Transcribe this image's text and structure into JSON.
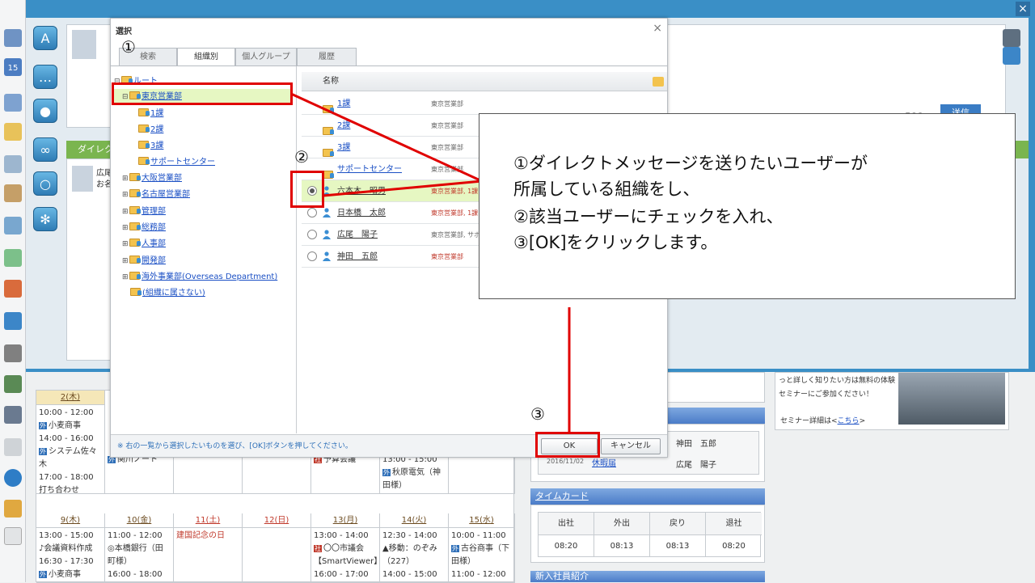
{
  "window": {
    "close_label": "×"
  },
  "calendar": {
    "week1": {
      "headers": [
        "2(木)"
      ],
      "cells": [
        {
          "t1": "10:00 - 12:00",
          "e1": "小麦商事",
          "t2": "14:00 - 16:00",
          "e2": "システム佐々木",
          "t3": "17:00 - 18:00",
          "e3": "打ち合わせ"
        },
        {
          "e1": "関川ノート"
        },
        {
          "e1": "予算会議"
        },
        {
          "t1": "13:00 - 15:00",
          "e1": "秋原電気（神田様）"
        }
      ]
    },
    "week2": {
      "headers": [
        "9(木)",
        "10(金)",
        "11(土)",
        "12(日)",
        "13(月)",
        "14(火)",
        "15(水)"
      ],
      "cells": [
        {
          "t1": "13:00 - 15:00",
          "e1": "会議資料作成",
          "t2": "16:30 - 17:30",
          "e2": "小麦商事"
        },
        {
          "t1": "11:00 - 12:00",
          "e1": "本橋銀行（田町様）",
          "t2": "16:00 - 18:00"
        },
        {
          "e1": "建国記念の日"
        },
        {},
        {
          "t1": "13:00 - 14:00",
          "e1": "〇〇市議会【SmartViewer】",
          "t2": "16:00 - 17:00"
        },
        {
          "t1": "12:30 - 14:00",
          "e1": "移動：のぞみ（227）",
          "t2": "14:00 - 15:00"
        },
        {
          "t1": "10:00 - 11:00",
          "e1": "古谷商事（下田様）",
          "t2": "11:00 - 12:00"
        }
      ]
    }
  },
  "right": {
    "seminar_text": "っと詳しく知りたい方は無料の体験セミナーにご参加ください！",
    "seminar_link_prefix": "セミナー詳細は<",
    "seminar_link": "こちら",
    "seminar_link_suffix": ">",
    "substitute": {
      "date": "2016/11/02",
      "link": "休暇届",
      "names": [
        "神田　五郎",
        "広尾　陽子"
      ]
    },
    "timecard": {
      "title": "タイムカード",
      "headers": [
        "出社",
        "外出",
        "戻り",
        "退社"
      ],
      "values": [
        "08:20",
        "08:13",
        "08:13",
        "08:20"
      ]
    },
    "newcomer_title": "新入社員紹介"
  },
  "behind": {
    "direct_label": "ダイレク",
    "sender_name": "広尾",
    "sender_prefix": "お名",
    "send_btn": "送信",
    "count": "500"
  },
  "dialog": {
    "title": "選択",
    "close": "×",
    "tabs": [
      "検索",
      "組織別",
      "個人グループ",
      "履歴"
    ],
    "tree": {
      "root": "ルート",
      "selected": "東京営業部",
      "children": [
        "1課",
        "2課",
        "3課",
        "サポートセンター"
      ],
      "others": [
        "大阪営業部",
        "名古屋営業部",
        "管理部",
        "総務部",
        "人事部",
        "開発部",
        "海外事業部(Overseas Department)",
        "(組織に属さない)"
      ]
    },
    "list_header": "名称",
    "folders": [
      {
        "name": "1課",
        "org": "東京営業部"
      },
      {
        "name": "2課",
        "org": "東京営業部"
      },
      {
        "name": "3課",
        "org": "東京営業部"
      },
      {
        "name": "サポートセンター",
        "org": "東京営業部"
      }
    ],
    "users": [
      {
        "name": "六本木　昭男",
        "org": "東京営業部, 1課"
      },
      {
        "name": "日本橋　太郎",
        "org": "東京営業部, 1課"
      },
      {
        "name": "広尾　陽子",
        "org": "東京営業部, サポ"
      },
      {
        "name": "神田　五郎",
        "org": "東京営業部"
      }
    ],
    "hint": "※ 右の一覧から選択したいものを選び、[OK]ボタンを押してください。",
    "ok": "OK",
    "cancel": "キャンセル"
  },
  "annotation": {
    "n1": "①",
    "n2": "②",
    "n3": "③",
    "line1": "①ダイレクトメッセージを送りたいユーザーが",
    "line2": "所属している組織をし、",
    "line3": "②該当ユーザーにチェックを入れ、",
    "line4": "③[OK]をクリックします。"
  },
  "colors": {
    "annotation_red": "#e00000",
    "frame_blue": "#3a8fc6",
    "selected_row": "#e6f7c2"
  }
}
